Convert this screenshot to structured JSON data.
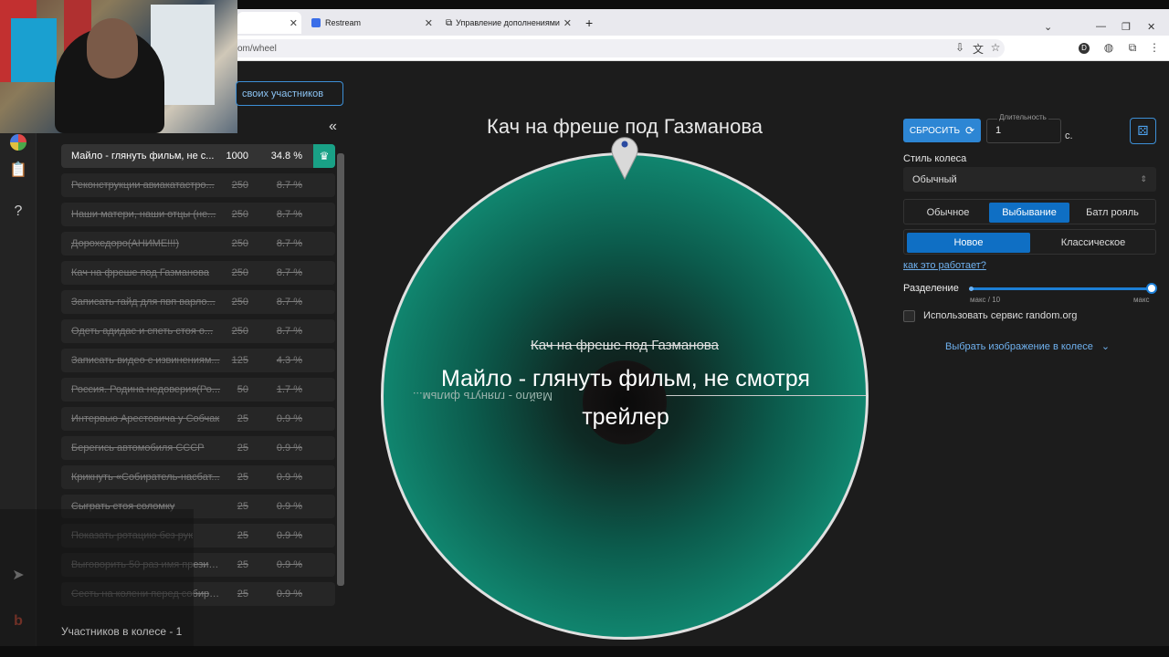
{
  "browser": {
    "tabs": [
      {
        "label": "",
        "active": true
      },
      {
        "label": "Restream",
        "icon": "restream-icon"
      },
      {
        "label": "Управление дополнениями",
        "icon": "puzzle-icon"
      }
    ],
    "url": "om/wheel"
  },
  "sidebar": {
    "add_button": "своих участников",
    "participants": [
      {
        "name": "Майло - глянуть фильм, не с...",
        "amount": "1000",
        "percent": "34.8 %",
        "active": true
      },
      {
        "name": "Реконструкции авиакатастро...",
        "amount": "250",
        "percent": "8.7 %"
      },
      {
        "name": "Наши матери, наши отцы (не...",
        "amount": "250",
        "percent": "8.7 %"
      },
      {
        "name": "Дорохедоро(АНИМЕ!!!)",
        "amount": "250",
        "percent": "8.7 %"
      },
      {
        "name": "Кач на фреше под Газманова",
        "amount": "250",
        "percent": "8.7 %"
      },
      {
        "name": "Записать гайд для пвп варло...",
        "amount": "250",
        "percent": "8.7 %"
      },
      {
        "name": "Одеть адидас и спеть стоя о...",
        "amount": "250",
        "percent": "8.7 %"
      },
      {
        "name": "Записать видео с извинениям...",
        "amount": "125",
        "percent": "4.3 %"
      },
      {
        "name": "Россия. Родина недоверия(Ро...",
        "amount": "50",
        "percent": "1.7 %"
      },
      {
        "name": "Интервью Арестовича у Собчак",
        "amount": "25",
        "percent": "0.9 %"
      },
      {
        "name": "Берегись автомобиля СССР",
        "amount": "25",
        "percent": "0.9 %"
      },
      {
        "name": "Крикнуть «Собиратель-насбат...",
        "amount": "25",
        "percent": "0.9 %"
      },
      {
        "name": "Сыграть стоя соломку",
        "amount": "25",
        "percent": "0.9 %"
      },
      {
        "name": "Показать ротацию без рук",
        "amount": "25",
        "percent": "0.9 %"
      },
      {
        "name": "Выговорить 50 раз имя президи...",
        "amount": "25",
        "percent": "0.9 %"
      },
      {
        "name": "Сесть на колени перед собира...",
        "amount": "25",
        "percent": "0.9 %"
      }
    ],
    "count_label": "Участников в колесе - 1"
  },
  "wheel": {
    "title": "Кач на фреше под Газманова",
    "eliminated": "Кач на фреше под Газманова",
    "winner": "Майло - глянуть фильм, не смотря трейлер",
    "mirrored_label": "Майло - глянуть фильм..."
  },
  "controls": {
    "reset_label": "СБРОСИТЬ",
    "duration_label": "Длительность",
    "duration_value": "1",
    "duration_unit": "с.",
    "style_label": "Стиль колеса",
    "style_value": "Обычный",
    "modes": [
      "Обычное",
      "Выбывание",
      "Батл рояль"
    ],
    "active_mode": "Выбывание",
    "submodes": [
      "Новое",
      "Классическое"
    ],
    "active_submode": "Новое",
    "how_link": "как это работает?",
    "split_label": "Разделение",
    "split_min": "макс / 10",
    "split_max": "макс",
    "random_org_label": "Использовать сервис random.org",
    "image_select_label": "Выбрать изображение в колесе"
  },
  "colors": {
    "accent": "#2d86d4",
    "wheel_green": "#1ea487",
    "win_badge": "#19a186"
  }
}
